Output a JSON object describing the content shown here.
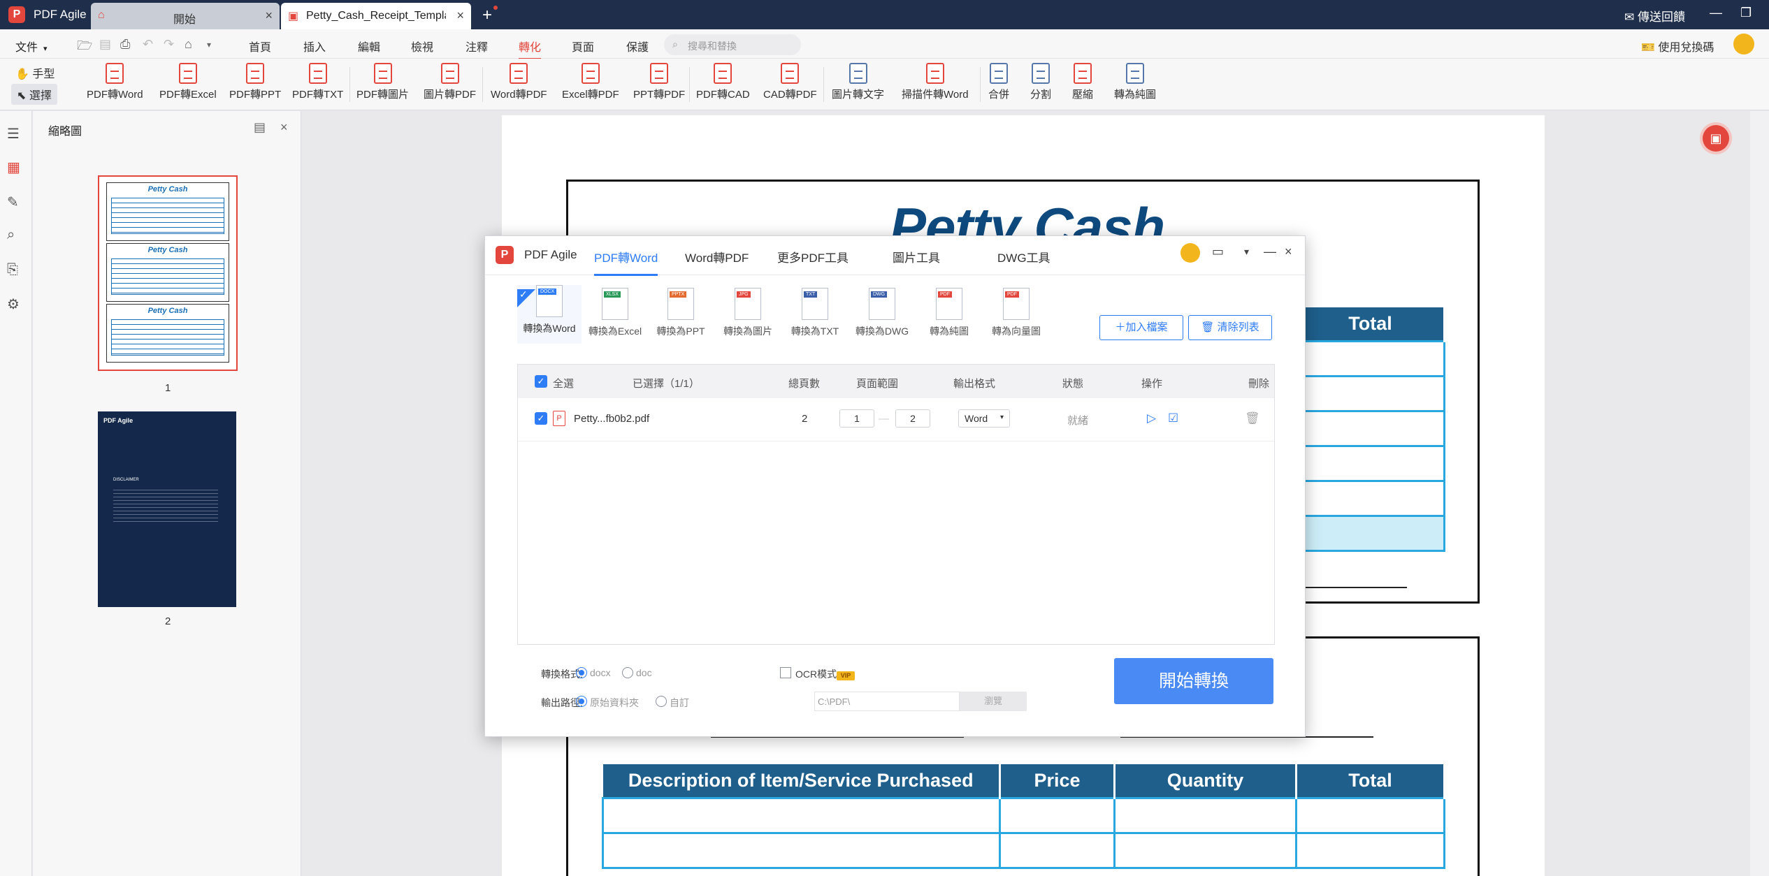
{
  "window": {
    "app_name": "PDF Agile",
    "tabs": [
      {
        "label": "開始"
      },
      {
        "label": "Petty_Cash_Receipt_Templat..."
      }
    ],
    "feedback": "傳送回饋"
  },
  "menubar": {
    "file": "文件",
    "items": [
      "首頁",
      "插入",
      "編輯",
      "檢視",
      "注釋",
      "轉化",
      "頁面",
      "保護"
    ],
    "active": "轉化",
    "search_placeholder": "搜尋和替換",
    "redeem": "使用兌換碼"
  },
  "ribbon": {
    "modes": [
      "手型",
      "選擇"
    ],
    "tools": [
      "PDF轉Word",
      "PDF轉Excel",
      "PDF轉PPT",
      "PDF轉TXT",
      "PDF轉圖片",
      "圖片轉PDF",
      "Word轉PDF",
      "Excel轉PDF",
      "PPT轉PDF",
      "PDF轉CAD",
      "CAD轉PDF",
      "圖片轉文字",
      "掃描件轉Word",
      "合併",
      "分割",
      "壓縮",
      "轉為純圖"
    ]
  },
  "thumbnails": {
    "title": "縮略圖",
    "pages": [
      "1",
      "2"
    ],
    "mini_title": "Petty Cash",
    "page2_brand": "PDF Agile",
    "page2_heading": "DISCLAIMER"
  },
  "document": {
    "receipt_title": "Petty Cash",
    "table_headers": [
      "Description of Item/Service Purchased",
      "Price",
      "Quantity",
      "Total"
    ],
    "top_header_visible": "Total"
  },
  "dialog": {
    "app_name": "PDF Agile",
    "tabs": [
      "PDF轉Word",
      "Word轉PDF",
      "更多PDF工具",
      "圖片工具",
      "DWG工具"
    ],
    "active_tab": "PDF轉Word",
    "modes": [
      "轉換為Word",
      "轉換為Excel",
      "轉換為PPT",
      "轉換為圖片",
      "轉換為TXT",
      "轉換為DWG",
      "轉為純圖",
      "轉為向量圖"
    ],
    "mode_tags": [
      "DOCX",
      "XLSX",
      "PPTX",
      "JPG",
      "TXT",
      "DWG",
      "PDF",
      "PDF"
    ],
    "add_files": "加入檔案",
    "clear_list": "清除列表",
    "list_headers": {
      "select_all": "全選",
      "selected": "已選擇（1/1）",
      "pages": "總頁數",
      "range": "頁面範圍",
      "format": "輸出格式",
      "status": "狀態",
      "action": "操作",
      "delete": "刪除"
    },
    "file_row": {
      "name": "Petty...fb0b2.pdf",
      "pages": "2",
      "range_from": "1",
      "range_to": "2",
      "format": "Word",
      "status": "就緒"
    },
    "convert_format_label": "轉換格式:",
    "format_options": [
      "docx",
      "doc"
    ],
    "ocr_label": "OCR模式",
    "vip": "VIP",
    "output_path_label": "輸出路徑:",
    "path_options": [
      "原始資料夾",
      "自訂"
    ],
    "path_value": "C:\\PDF\\",
    "browse": "瀏覽",
    "start": "開始轉換"
  }
}
